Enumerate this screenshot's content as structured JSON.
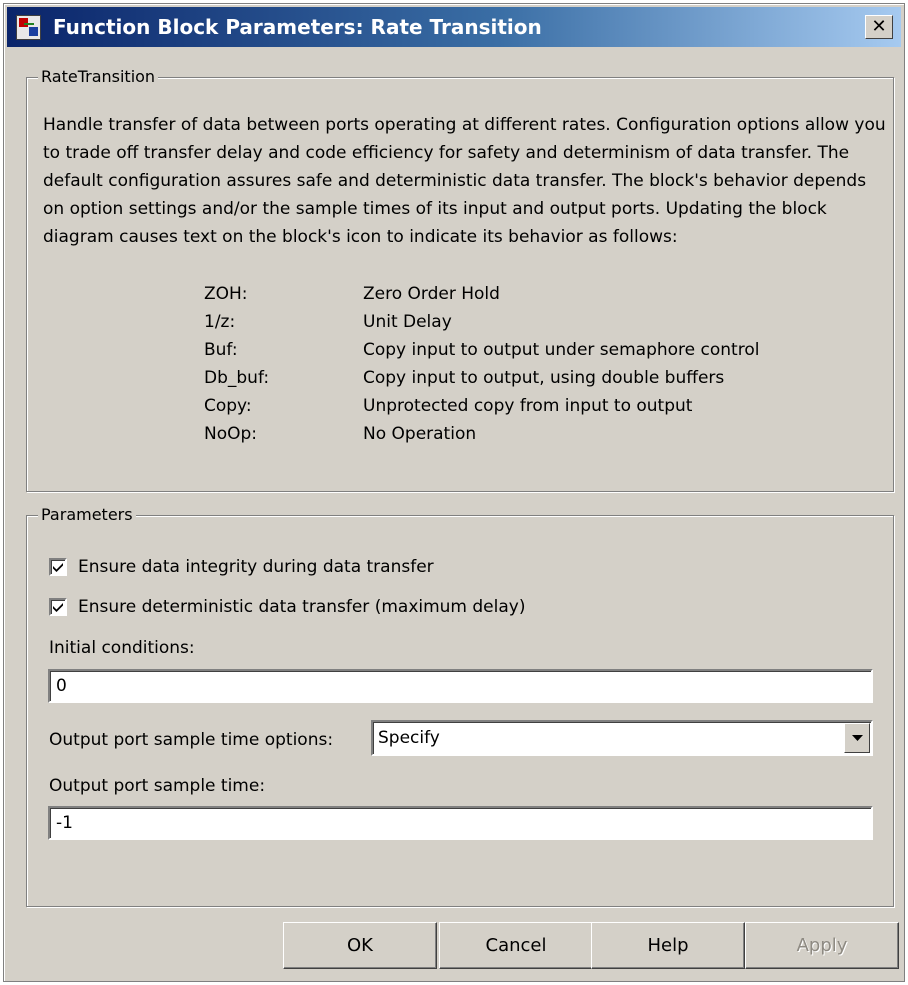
{
  "window": {
    "title": "Function Block Parameters: Rate Transition",
    "close_glyph": "✕",
    "app_icon": "simulink-block-icon"
  },
  "description_group": {
    "label": "RateTransition",
    "text": "Handle transfer of data between ports operating at different rates. Configuration options allow you to trade off transfer delay and code efficiency for safety and determinism of data transfer. The default configuration assures safe and deterministic data transfer. The block's behavior depends on option settings and/or the sample times of its input and output ports. Updating the block diagram causes text on the block's icon to indicate its behavior as follows:",
    "legend": [
      {
        "code": "ZOH:",
        "meaning": "Zero Order Hold"
      },
      {
        "code": "1/z:",
        "meaning": "Unit Delay"
      },
      {
        "code": "Buf:",
        "meaning": "Copy input to output under semaphore control"
      },
      {
        "code": "Db_buf:",
        "meaning": "Copy input to output, using double buffers"
      },
      {
        "code": "Copy:",
        "meaning": "Unprotected copy from input to output"
      },
      {
        "code": "NoOp:",
        "meaning": "No Operation"
      }
    ]
  },
  "parameters": {
    "label": "Parameters",
    "ensure_integrity": {
      "label": "Ensure data integrity during data transfer",
      "checked": true
    },
    "ensure_deterministic": {
      "label": "Ensure deterministic data transfer (maximum delay)",
      "checked": true
    },
    "initial_conditions": {
      "label": "Initial conditions:",
      "value": "0"
    },
    "sample_time_options": {
      "label": "Output port sample time options:",
      "value": "Specify"
    },
    "sample_time": {
      "label": "Output port sample time:",
      "value": "-1"
    }
  },
  "buttons": {
    "ok": "OK",
    "cancel": "Cancel",
    "help": "Help",
    "apply": "Apply"
  },
  "colors": {
    "dialog_face": "#d4d0c8",
    "title_gradient_start": "#0a246a",
    "title_gradient_end": "#a6caf0",
    "disabled_text": "#8e8a82"
  }
}
